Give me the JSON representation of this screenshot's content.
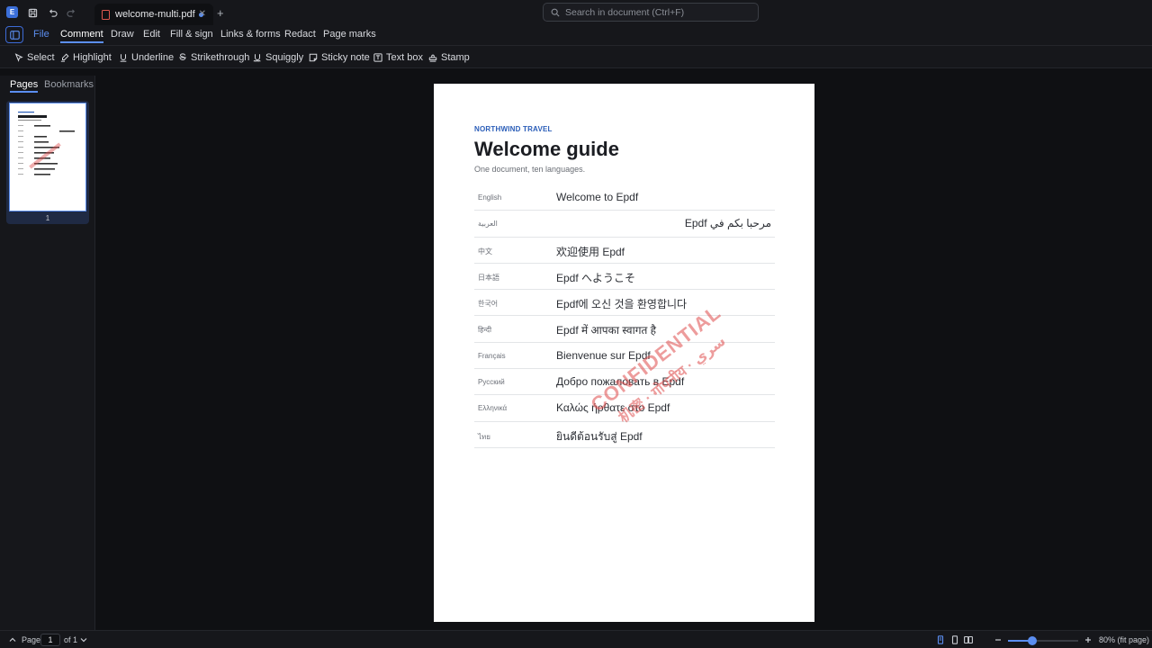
{
  "app": {
    "logo_letter": "E"
  },
  "tab": {
    "filename": "welcome-multi.pdf"
  },
  "search": {
    "placeholder": "Search in document (Ctrl+F)"
  },
  "menu": [
    "File",
    "Comment",
    "Draw",
    "Edit",
    "Fill & sign",
    "Links & forms",
    "Redact",
    "Page marks"
  ],
  "tools": [
    "Select",
    "Highlight",
    "Underline",
    "Strikethrough",
    "Squiggly",
    "Sticky note",
    "Text box",
    "Stamp"
  ],
  "sidebar": {
    "tabs": [
      "Pages",
      "Bookmarks"
    ],
    "thumb_label": "1"
  },
  "document": {
    "brand": "NORTHWIND TRAVEL",
    "title": "Welcome guide",
    "subtitle": "One document, ten languages.",
    "rows": [
      {
        "lang": "English",
        "greeting": "Welcome to Epdf"
      },
      {
        "lang": "العربية",
        "greeting": "مرحبا بكم في Epdf"
      },
      {
        "lang": "中文",
        "greeting": "欢迎使用 Epdf"
      },
      {
        "lang": "日本語",
        "greeting": "Epdf へようこそ"
      },
      {
        "lang": "한국어",
        "greeting": "Epdf에 오신 것을 환영합니다"
      },
      {
        "lang": "हिन्दी",
        "greeting": "Epdf में आपका स्वागत है"
      },
      {
        "lang": "Français",
        "greeting": "Bienvenue sur Epdf"
      },
      {
        "lang": "Русский",
        "greeting": "Добро пожаловать в Epdf"
      },
      {
        "lang": "Ελληνικά",
        "greeting": "Καλώς ήρθατε στο Epdf"
      },
      {
        "lang": "ไทย",
        "greeting": "ยินดีต้อนรับสู่ Epdf"
      }
    ],
    "stamp": {
      "line1": "CONFIDENTIAL",
      "line2": "机密 · गोपनीय · سري"
    }
  },
  "status": {
    "page_label": "Page",
    "page_value": "1",
    "page_of": "of 1",
    "zoom_text": "80% (fit page)",
    "zoom_level": 0.35
  },
  "colors": {
    "accent": "#5b8ef0",
    "brand": "#2a5db8",
    "stamp": "#de4b4b"
  }
}
